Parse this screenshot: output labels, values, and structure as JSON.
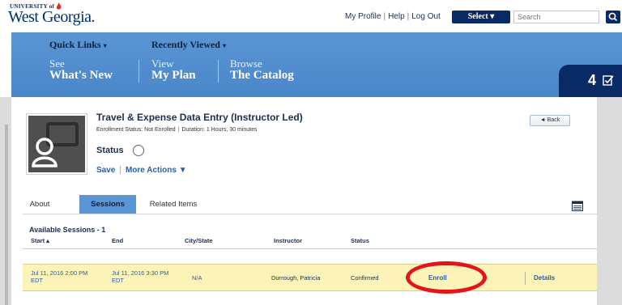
{
  "logo": {
    "university": "UNIVERSITY of",
    "name": "West Georgia."
  },
  "toplinks": {
    "profile": "My Profile",
    "help": "Help",
    "logout": "Log Out",
    "sep": "|"
  },
  "header": {
    "select_label": "Select ▾",
    "search_placeholder": "Search"
  },
  "nav": {
    "quick_links": "Quick Links",
    "recently_viewed": "Recently Viewed",
    "caret": "▾",
    "links": [
      {
        "small": "See",
        "big": "What's New"
      },
      {
        "small": "View",
        "big": "My Plan"
      },
      {
        "small": "Browse",
        "big": "The Catalog"
      }
    ]
  },
  "badge": {
    "count": "4"
  },
  "course": {
    "title": "Travel & Expense Data Entry (Instructor Led)",
    "enrollment_status": "Enrollment Status: Not Enrolled",
    "duration": "Duration: 1 Hours, 30 minutes",
    "status_label": "Status",
    "save_label": "Save",
    "more_actions_label": "More Actions ▼",
    "back_label": "◄ Back"
  },
  "tabs": [
    {
      "label": "About",
      "active": false
    },
    {
      "label": "Sessions",
      "active": true
    },
    {
      "label": "Related Items",
      "active": false
    }
  ],
  "sessions": {
    "heading": "Available Sessions - 1",
    "columns": {
      "start": "Start ▴",
      "end": "End",
      "city": "City/State",
      "instructor": "Instructor",
      "status": "Status"
    },
    "rows": [
      {
        "start_date": "Jul 11, 2016 2:00 PM",
        "start_tz": "EDT",
        "end_date": "Jul 11, 2016 3:30 PM",
        "end_tz": "EDT",
        "city": "N/A",
        "instructor": "Durrough, Patricia",
        "status": "Confirmed",
        "enroll_label": "Enroll",
        "details_label": "Details"
      }
    ]
  },
  "icons": {
    "logo_flame": "flame-icon",
    "search": "search-icon",
    "badge_check": "checkmark-box-icon",
    "course_thumb": "person-presentation-icon",
    "calendar": "calendar-icon"
  },
  "colors": {
    "navy": "#0a2a66",
    "nav_blue": "#5a95d4",
    "row_highlight": "#fbf3b8",
    "link_blue": "#2b5f9e",
    "annotation_red": "#e4141b"
  }
}
